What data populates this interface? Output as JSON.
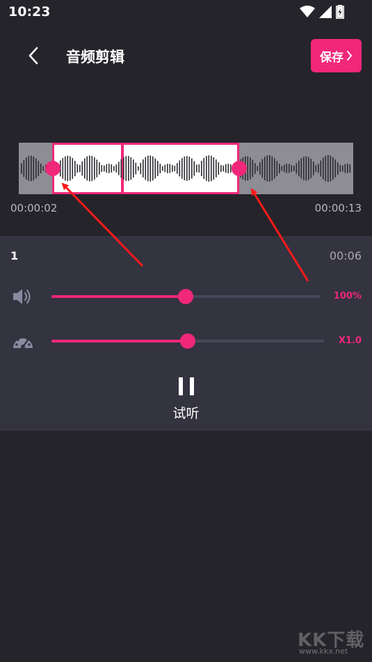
{
  "status_bar": {
    "time": "10:23",
    "icons": [
      "wifi-icon",
      "signal-icon",
      "battery-charging-icon"
    ]
  },
  "header": {
    "title": "音频剪辑",
    "save_label": "保存",
    "back_icon": "chevron-left-icon",
    "save_icon": "chevron-right-icon"
  },
  "waveform": {
    "start_time": "00:00:02",
    "end_time": "00:00:13",
    "selection_color": "#f1277a"
  },
  "panel": {
    "segment_index": "1",
    "segment_duration": "00:06",
    "volume": {
      "icon": "speaker-icon",
      "value_label": "100%",
      "level": 0.5
    },
    "speed": {
      "icon": "speedometer-icon",
      "value_label": "X1.0",
      "level": 0.5
    },
    "preview_label": "试听",
    "play_state_icon": "pause-icon"
  },
  "watermark": {
    "text": "KK下载",
    "url": "www.kkx.net"
  },
  "colors": {
    "accent": "#f1277a",
    "background": "#25242a",
    "panel": "#343340"
  }
}
